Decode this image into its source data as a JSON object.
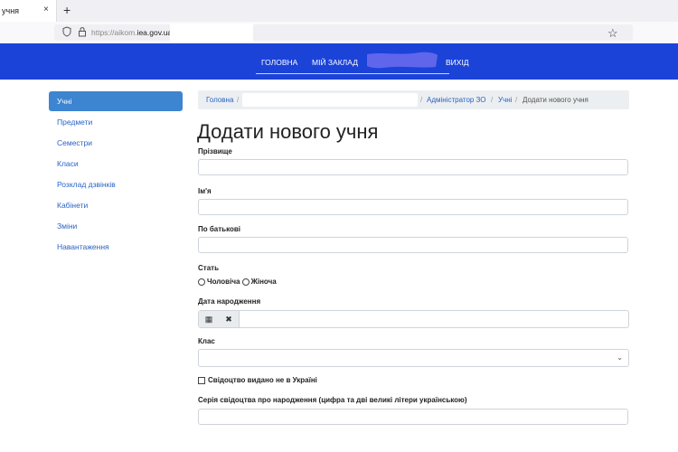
{
  "browser": {
    "tab_title": "учня",
    "tab_close": "×",
    "new_tab": "+",
    "url_prefix": "https://aikom.",
    "url_domain": "iea.gov.ua",
    "url_suffix": "/",
    "bookmark_icon": "star-icon"
  },
  "navbar": {
    "links": [
      "ГОЛОВНА",
      "МІЙ ЗАКЛАД",
      "ВИХІД"
    ],
    "accent": "#1c43d8"
  },
  "sidebar": {
    "items": [
      {
        "label": "Учні",
        "active": true
      },
      {
        "label": "Предмети"
      },
      {
        "label": "Семестри"
      },
      {
        "label": "Класи"
      },
      {
        "label": "Розклад дзвінків"
      },
      {
        "label": "Кабінети"
      },
      {
        "label": "Зміни"
      },
      {
        "label": "Навантаження"
      }
    ]
  },
  "breadcrumb": {
    "home": "Головна",
    "sep": "/",
    "admin": "Адміністратор ЗО",
    "students": "Учні",
    "current": "Додати нового учня"
  },
  "page": {
    "title": "Додати нового учня"
  },
  "form": {
    "surname_label": "Прізвище",
    "name_label": "Ім'я",
    "patronymic_label": "По батькові",
    "gender_label": "Стать",
    "gender_options": [
      "Чоловіча",
      "Жіноча"
    ],
    "birthdate_label": "Дата народження",
    "class_label": "Клас",
    "foreign_cert_label": "Свідоцтво видано не в Україні",
    "cert_series_label": "Серія свідоцтва про народження (цифра та дві великі літери українською)"
  }
}
